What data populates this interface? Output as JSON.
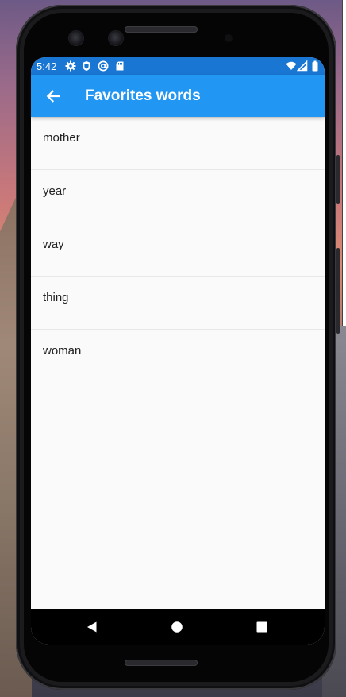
{
  "status_bar": {
    "time": "5:42",
    "left_icons": [
      "gear-icon",
      "shield-icon",
      "at-sign-icon",
      "sd-card-icon"
    ],
    "right_icons": [
      "wifi-icon",
      "signal-icon",
      "battery-icon"
    ],
    "color": "#1976d2"
  },
  "app_bar": {
    "title": "Favorites words",
    "back_icon": "arrow-left-icon",
    "color": "#2196f3"
  },
  "words": [
    "mother",
    "year",
    "way",
    "thing",
    "woman"
  ],
  "nav_bar": {
    "buttons": [
      "back-triangle-icon",
      "home-circle-icon",
      "recents-square-icon"
    ]
  }
}
